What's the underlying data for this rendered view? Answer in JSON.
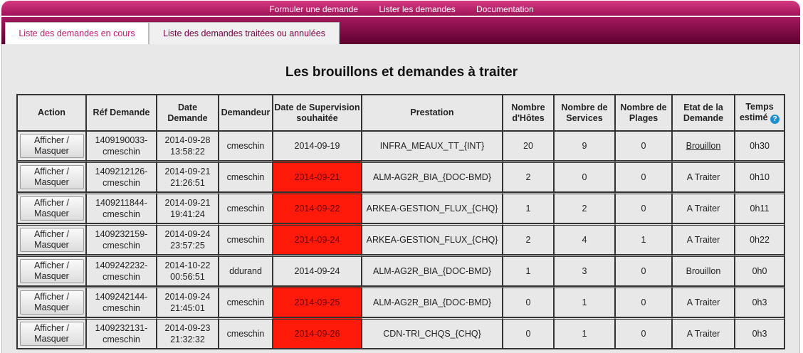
{
  "topnav": [
    "Formuler une demande",
    "Lister les demandes",
    "Documentation"
  ],
  "tabs": [
    "Liste des demandes en cours",
    "Liste des demandes traitées ou annulées"
  ],
  "title": "Les brouillons et demandes à traiter",
  "columns": [
    "Action",
    "Réf Demande",
    "Date Demande",
    "Demandeur",
    "Date de Supervision souhaitée",
    "Prestation",
    "Nombre d'Hôtes",
    "Nombre de Services",
    "Nombre de Plages",
    "Etat de la Demande",
    "Temps estimé"
  ],
  "help_icon": "?",
  "colors": {
    "overdue": "#ff1a0a",
    "brand": "#c0186a"
  },
  "rows": [
    {
      "action": "Afficher / Masquer",
      "ref": "1409190033-cmeschin",
      "date": "2014-09-28 13:58:22",
      "user": "cmeschin",
      "sup": "2014-09-19",
      "overdue": false,
      "prest": "INFRA_MEAUX_TT_{INT}",
      "hotes": "20",
      "services": "9",
      "plages": "0",
      "etat": "Brouillon",
      "etat_link": true,
      "temps": "0h30"
    },
    {
      "action": "Afficher / Masquer",
      "ref": "1409212126-cmeschin",
      "date": "2014-09-21 21:26:51",
      "user": "cmeschin",
      "sup": "2014-09-21",
      "overdue": true,
      "prest": "ALM-AG2R_BIA_{DOC-BMD}",
      "hotes": "2",
      "services": "0",
      "plages": "0",
      "etat": "A Traiter",
      "etat_link": false,
      "temps": "0h10"
    },
    {
      "action": "Afficher / Masquer",
      "ref": "1409211844-cmeschin",
      "date": "2014-09-21 19:41:24",
      "user": "cmeschin",
      "sup": "2014-09-22",
      "overdue": true,
      "prest": "ARKEA-GESTION_FLUX_{CHQ}",
      "hotes": "1",
      "services": "2",
      "plages": "0",
      "etat": "A Traiter",
      "etat_link": false,
      "temps": "0h11"
    },
    {
      "action": "Afficher / Masquer",
      "ref": "1409232159-cmeschin",
      "date": "2014-09-24 23:57:25",
      "user": "cmeschin",
      "sup": "2014-09-24",
      "overdue": true,
      "prest": "ARKEA-GESTION_FLUX_{CHQ}",
      "hotes": "2",
      "services": "4",
      "plages": "1",
      "etat": "A Traiter",
      "etat_link": false,
      "temps": "0h22"
    },
    {
      "action": "Afficher / Masquer",
      "ref": "1409242232-cmeschin",
      "date": "2014-10-22 00:56:51",
      "user": "ddurand",
      "sup": "2014-09-24",
      "overdue": false,
      "prest": "ALM-AG2R_BIA_{DOC-BMD}",
      "hotes": "1",
      "services": "3",
      "plages": "0",
      "etat": "Brouillon",
      "etat_link": false,
      "temps": "0h0"
    },
    {
      "action": "Afficher / Masquer",
      "ref": "1409242144-cmeschin",
      "date": "2014-09-24 21:45:01",
      "user": "cmeschin",
      "sup": "2014-09-25",
      "overdue": true,
      "prest": "ALM-AG2R_BIA_{DOC-BMD}",
      "hotes": "0",
      "services": "1",
      "plages": "0",
      "etat": "A Traiter",
      "etat_link": false,
      "temps": "0h3"
    },
    {
      "action": "Afficher / Masquer",
      "ref": "1409232131-cmeschin",
      "date": "2014-09-23 21:32:32",
      "user": "cmeschin",
      "sup": "2014-09-26",
      "overdue": true,
      "prest": "CDN-TRI_CHQS_{CHQ}",
      "hotes": "0",
      "services": "1",
      "plages": "0",
      "etat": "A Traiter",
      "etat_link": false,
      "temps": "0h3"
    }
  ]
}
